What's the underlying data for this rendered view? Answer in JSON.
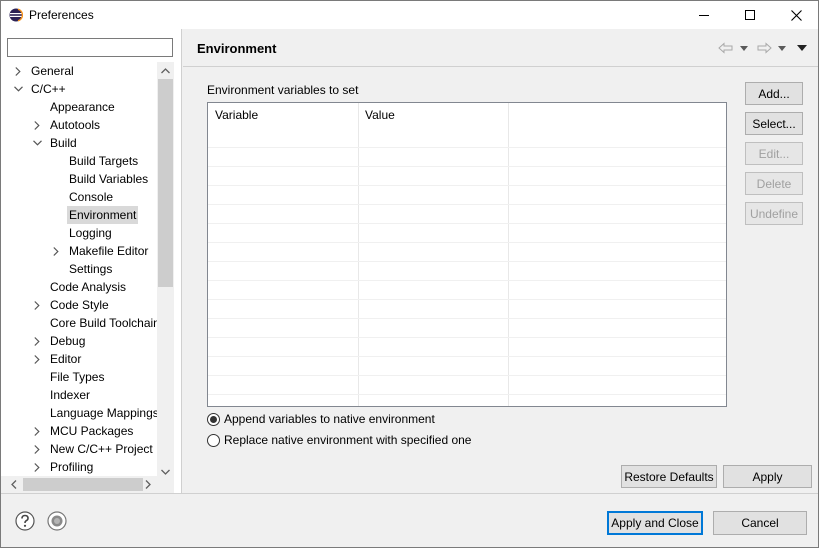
{
  "window": {
    "title": "Preferences",
    "icon": "eclipse-icon"
  },
  "sidebar": {
    "filter_placeholder": "",
    "filter_value": "",
    "tree": [
      {
        "label": "General",
        "arrow": "collapsed"
      },
      {
        "label": "C/C++",
        "arrow": "expanded"
      },
      {
        "label": "Appearance",
        "arrow": "none"
      },
      {
        "label": "Autotools",
        "arrow": "collapsed"
      },
      {
        "label": "Build",
        "arrow": "expanded"
      },
      {
        "label": "Build Targets",
        "arrow": "none"
      },
      {
        "label": "Build Variables",
        "arrow": "none"
      },
      {
        "label": "Console",
        "arrow": "none"
      },
      {
        "label": "Environment",
        "arrow": "none",
        "selected": true
      },
      {
        "label": "Logging",
        "arrow": "none"
      },
      {
        "label": "Makefile Editor",
        "arrow": "collapsed"
      },
      {
        "label": "Settings",
        "arrow": "none"
      },
      {
        "label": "Code Analysis",
        "arrow": "none"
      },
      {
        "label": "Code Style",
        "arrow": "collapsed"
      },
      {
        "label": "Core Build Toolchain",
        "arrow": "none"
      },
      {
        "label": "Debug",
        "arrow": "collapsed"
      },
      {
        "label": "Editor",
        "arrow": "collapsed"
      },
      {
        "label": "File Types",
        "arrow": "none"
      },
      {
        "label": "Indexer",
        "arrow": "none"
      },
      {
        "label": "Language Mappings",
        "arrow": "none"
      },
      {
        "label": "MCU Packages",
        "arrow": "collapsed"
      },
      {
        "label": "New C/C++ Project",
        "arrow": "collapsed"
      },
      {
        "label": "Profiling",
        "arrow": "collapsed"
      }
    ]
  },
  "page": {
    "title": "Environment",
    "table_label": "Environment variables to set",
    "columns": [
      "Variable",
      "Value"
    ],
    "rows": [],
    "buttons": {
      "add": "Add...",
      "select": "Select...",
      "edit": "Edit...",
      "delete": "Delete",
      "undefine": "Undefine"
    },
    "radio_append": "Append variables to native environment",
    "radio_replace": "Replace native environment with specified one",
    "radio_selected": "append",
    "restore_defaults": "Restore Defaults",
    "apply": "Apply"
  },
  "footer": {
    "apply_close": "Apply and Close",
    "cancel": "Cancel",
    "help_icon": "help-icon",
    "import_export_icon": "import-export-icon"
  },
  "colors": {
    "accent": "#0078d7",
    "selection": "#d9d9d9",
    "panel": "#f0f0f0"
  }
}
